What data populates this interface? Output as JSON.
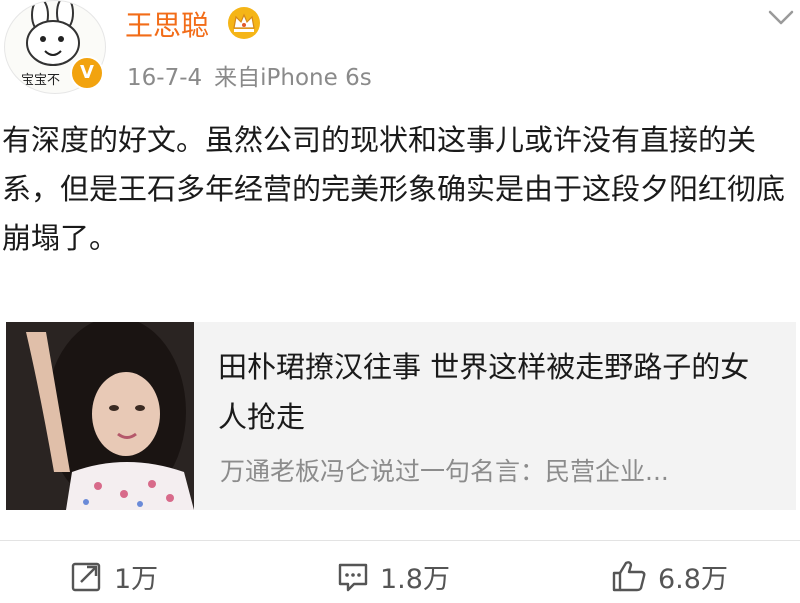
{
  "post": {
    "author": "王思聪",
    "avatar_caption": "宝宝不",
    "verified_badge": "V",
    "date": "16-7-4",
    "source": "来自iPhone 6s",
    "text": "有深度的好文。虽然公司的现状和这事儿或许没有直接的关系，但是王石多年经营的完美形象确实是由于这段夕阳红彻底崩塌了。"
  },
  "card": {
    "title": "田朴珺撩汉往事 世界这样被走野路子的女人抢走",
    "description": "万通老板冯仑说过一句名言：民营企业..."
  },
  "actions": {
    "repost_count": "1万",
    "comment_count": "1.8万",
    "like_count": "6.8万"
  },
  "colors": {
    "author_name": "#f26c18",
    "badge": "#f2a30f",
    "meta": "#8a8a8a"
  },
  "icons": [
    "crown-icon",
    "chevron-down-icon",
    "repost-icon",
    "comment-icon",
    "like-icon"
  ]
}
